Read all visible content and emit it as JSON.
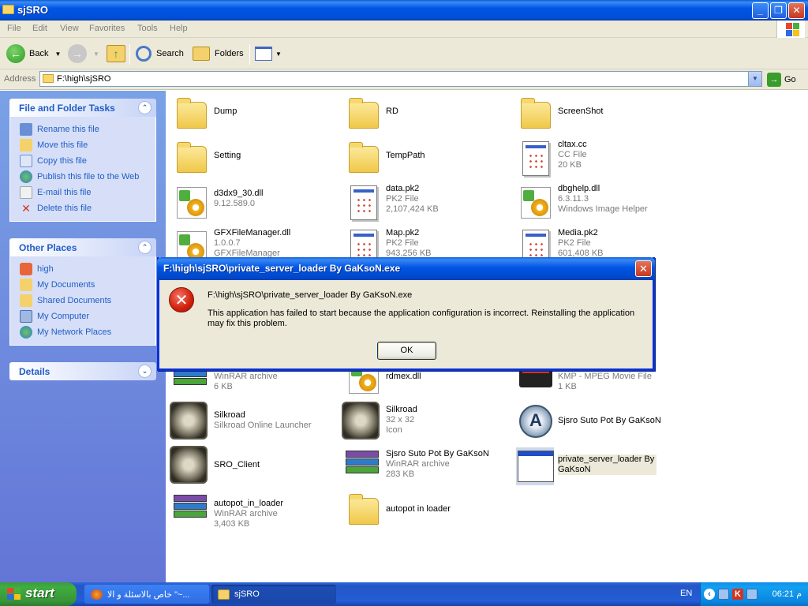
{
  "window": {
    "title": "sjSRO",
    "controls": [
      "_",
      "❐",
      "✕"
    ]
  },
  "menu": [
    "File",
    "Edit",
    "View",
    "Favorites",
    "Tools",
    "Help"
  ],
  "toolbar": {
    "back": "Back",
    "search": "Search",
    "folders": "Folders"
  },
  "address": {
    "label": "Address",
    "value": "F:\\high\\sjSRO",
    "go": "Go"
  },
  "tasks_panel": {
    "title": "File and Folder Tasks",
    "items": [
      "Rename this file",
      "Move this file",
      "Copy this file",
      "Publish this file to the Web",
      "E-mail this file",
      "Delete this file"
    ]
  },
  "places_panel": {
    "title": "Other Places",
    "items": [
      "high",
      "My Documents",
      "Shared Documents",
      "My Computer",
      "My Network Places"
    ]
  },
  "details_panel": {
    "title": "Details"
  },
  "files": [
    {
      "name": "Dump",
      "line2": "",
      "line3": "",
      "icon": "folder"
    },
    {
      "name": "RD",
      "line2": "",
      "line3": "",
      "icon": "folder"
    },
    {
      "name": "ScreenShot",
      "line2": "",
      "line3": "",
      "icon": "folder"
    },
    {
      "name": "Setting",
      "line2": "",
      "line3": "",
      "icon": "folder"
    },
    {
      "name": "TempPath",
      "line2": "",
      "line3": "",
      "icon": "folder"
    },
    {
      "name": "cltax.cc",
      "line2": "CC File",
      "line3": "20 KB",
      "icon": "doc"
    },
    {
      "name": "d3dx9_30.dll",
      "line2": "9.12.589.0",
      "line3": "",
      "icon": "dll"
    },
    {
      "name": "data.pk2",
      "line2": "PK2 File",
      "line3": "2,107,424 KB",
      "icon": "doc"
    },
    {
      "name": "dbghelp.dll",
      "line2": "6.3.11.3",
      "line3": "Windows Image Helper",
      "icon": "dll"
    },
    {
      "name": "GFXFileManager.dll",
      "line2": "1.0.0.7",
      "line3": "GFXFileManager",
      "icon": "dll"
    },
    {
      "name": "Map.pk2",
      "line2": "PK2 File",
      "line3": "943,256 KB",
      "icon": "doc"
    },
    {
      "name": "Media.pk2",
      "line2": "PK2 File",
      "line3": "601,408 KB",
      "icon": "doc"
    },
    {
      "name": "",
      "line2": "WinRAR archive",
      "line3": "6 KB",
      "icon": "rar"
    },
    {
      "name": "rdmex.dll",
      "line2": "",
      "line3": "",
      "icon": "dll"
    },
    {
      "name": "",
      "line2": "KMP - MPEG Movie File",
      "line3": "1 KB",
      "icon": "kmp"
    },
    {
      "name": "Silkroad",
      "line2": "Silkroad Online Launcher",
      "line3": "",
      "icon": "sro"
    },
    {
      "name": "Silkroad",
      "line2": "32 x 32",
      "line3": "Icon",
      "icon": "sro"
    },
    {
      "name": "Sjsro Suto Pot By GaKsoN",
      "line2": "",
      "line3": "",
      "icon": "autoit"
    },
    {
      "name": "SRO_Client",
      "line2": "",
      "line3": "",
      "icon": "sro"
    },
    {
      "name": "Sjsro Suto Pot By GaKsoN",
      "line2": "WinRAR archive",
      "line3": "283 KB",
      "icon": "rar"
    },
    {
      "name": "private_server_loader By GaKsoN",
      "line2": "",
      "line3": "",
      "icon": "exe"
    },
    {
      "name": "autopot_in_loader",
      "line2": "WinRAR archive",
      "line3": "3,403 KB",
      "icon": "rar"
    },
    {
      "name": "autopot in loader",
      "line2": "",
      "line3": "",
      "icon": "folder"
    }
  ],
  "dialog": {
    "title": "F:\\high\\sjSRO\\private_server_loader By GaKsoN.exe",
    "path": "F:\\high\\sjSRO\\private_server_loader By GaKsoN.exe",
    "message": "This application has failed to start because the application configuration is incorrect. Reinstalling the application may fix this problem.",
    "ok": "OK"
  },
  "taskbar": {
    "start": "start",
    "tasks": [
      "خاص بالاسئلة و الا \"~...",
      "sjSRO"
    ],
    "lang": "EN",
    "clock": "06:21 م"
  }
}
